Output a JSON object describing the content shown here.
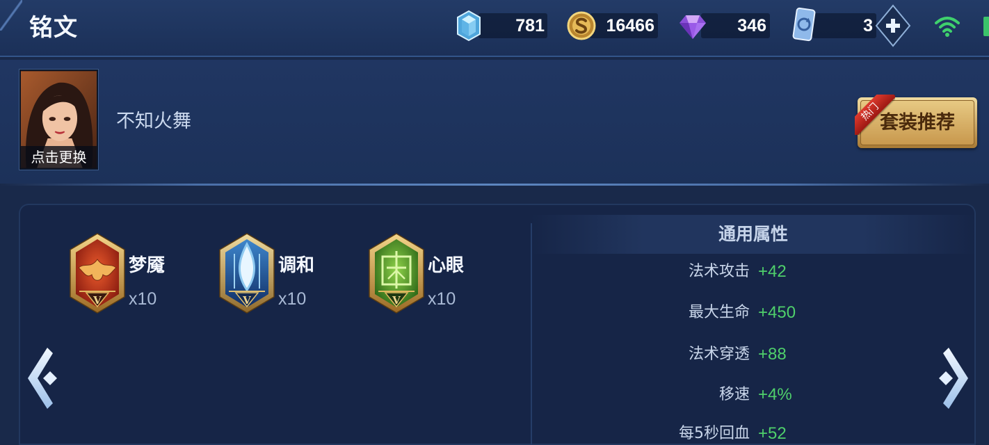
{
  "header": {
    "title": "铭文",
    "currencies": [
      {
        "icon": "crystal-icon",
        "value": "781"
      },
      {
        "icon": "gold-coin-icon",
        "value": "16466"
      },
      {
        "icon": "diamond-icon",
        "value": "346"
      },
      {
        "icon": "card-icon",
        "value": "3"
      }
    ],
    "add_button_icon": "plus-icon",
    "status_icons": [
      "wifi-icon",
      "battery-icon"
    ]
  },
  "hero": {
    "avatar_label": "点击更换",
    "name": "不知火舞",
    "recommend_button": "套装推荐",
    "hot_tag": "热门"
  },
  "inscriptions": [
    {
      "name": "梦魇",
      "count": "x10",
      "level": "V",
      "color": "#c0341c"
    },
    {
      "name": "调和",
      "count": "x10",
      "level": "V",
      "color": "#2f6fb8"
    },
    {
      "name": "心眼",
      "count": "x10",
      "level": "V",
      "color": "#5aa02c"
    }
  ],
  "stats": {
    "title": "通用属性",
    "items": [
      {
        "label": "法术攻击",
        "value": "+42"
      },
      {
        "label": "最大生命",
        "value": "+450"
      },
      {
        "label": "法术穿透",
        "value": "+88"
      },
      {
        "label": "移速",
        "value": "+4%"
      },
      {
        "label": "每5秒回血",
        "value": "+52"
      }
    ]
  },
  "navigation": {
    "prev_icon": "chevron-left-icon",
    "next_icon": "chevron-right-icon"
  },
  "colors": {
    "background": "#19294a",
    "stat_value_green": "#4fd06b",
    "gold": "#e2bf73",
    "hot_red": "#d02a22",
    "wifi_green": "#3fd16d"
  }
}
